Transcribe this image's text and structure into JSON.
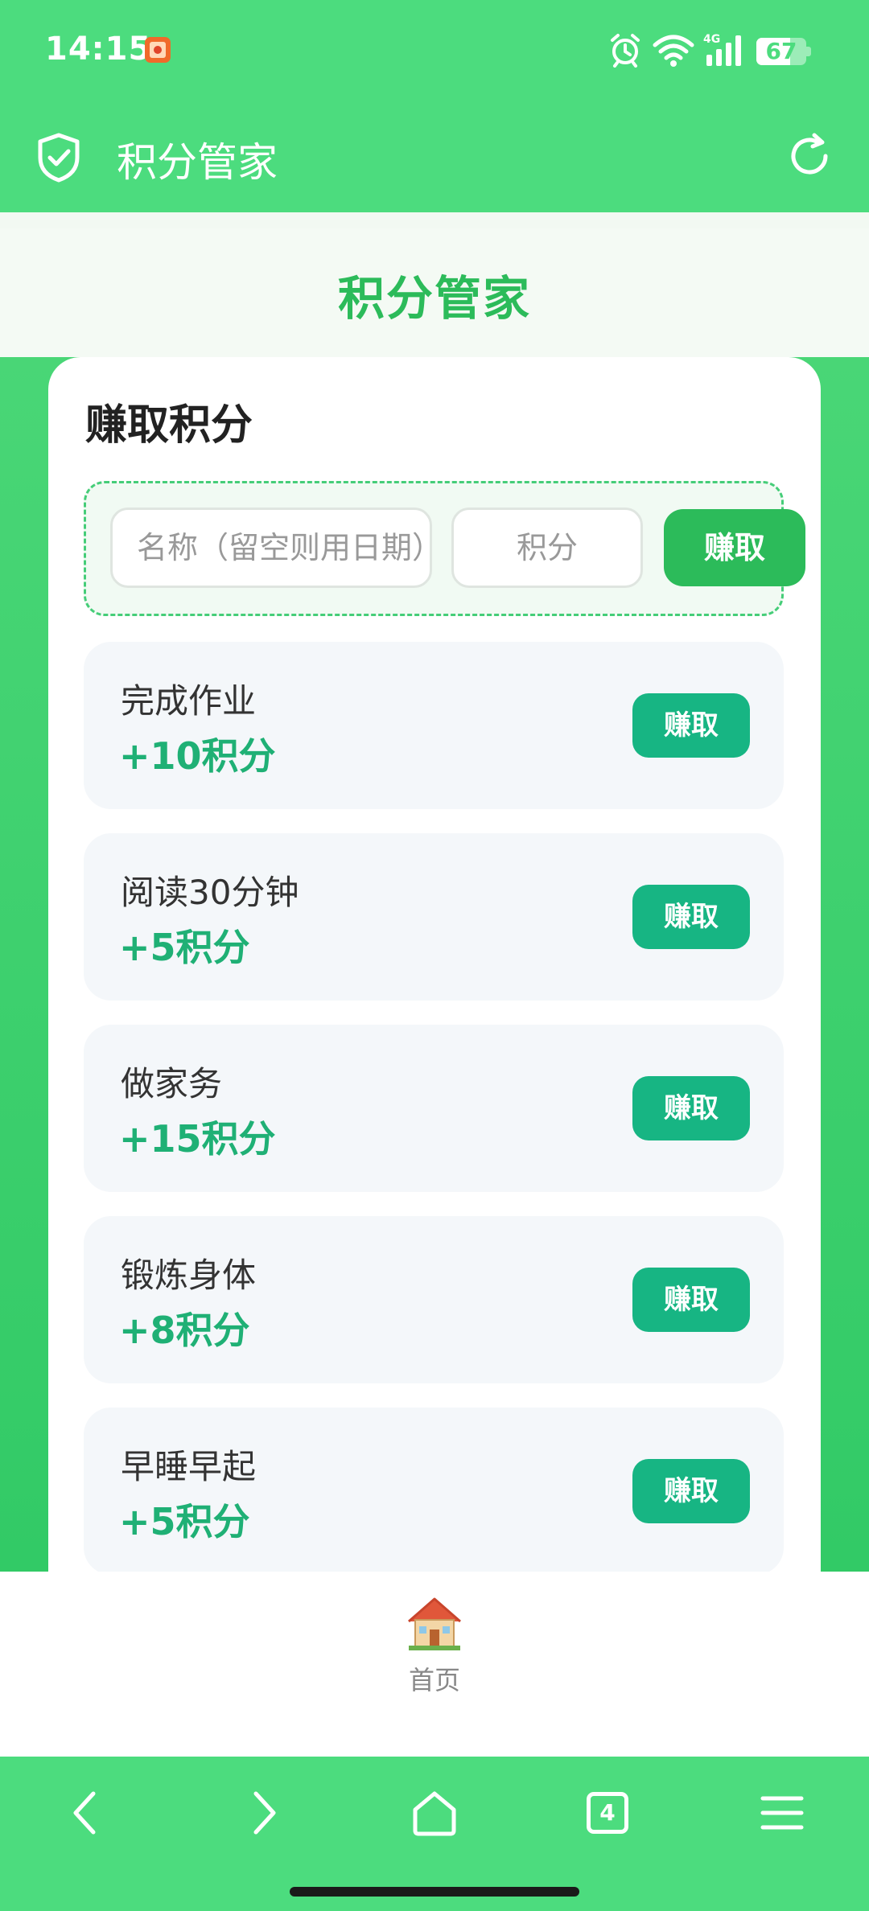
{
  "status_bar": {
    "time": "14:15",
    "network": "4G",
    "battery_level": 67,
    "battery_text": "67"
  },
  "app_bar": {
    "title": "积分管家",
    "icons": [
      "shield-check-icon",
      "refresh-icon"
    ]
  },
  "header": {
    "title": "积分管家"
  },
  "earn_card": {
    "title": "赚取积分",
    "form": {
      "name_placeholder": "名称（留空则用日期）",
      "points_placeholder": "积分",
      "submit_label": "赚取"
    },
    "tasks": [
      {
        "name": "完成作业",
        "points": "+10积分",
        "button": "赚取"
      },
      {
        "name": "阅读30分钟",
        "points": "+5积分",
        "button": "赚取"
      },
      {
        "name": "做家务",
        "points": "+15积分",
        "button": "赚取"
      },
      {
        "name": "锻炼身体",
        "points": "+8积分",
        "button": "赚取"
      },
      {
        "name": "早睡早起",
        "points": "+5积分",
        "button": "赚取"
      }
    ]
  },
  "tab_bar": {
    "items": [
      {
        "label": "首页",
        "icon": "house-icon"
      }
    ]
  },
  "browser_nav": {
    "tabs_count": "4"
  },
  "colors": {
    "primary_green": "#4cdc7e",
    "accent_green": "#2cbb5a",
    "task_button": "#17b583",
    "points_text": "#1fb075"
  }
}
